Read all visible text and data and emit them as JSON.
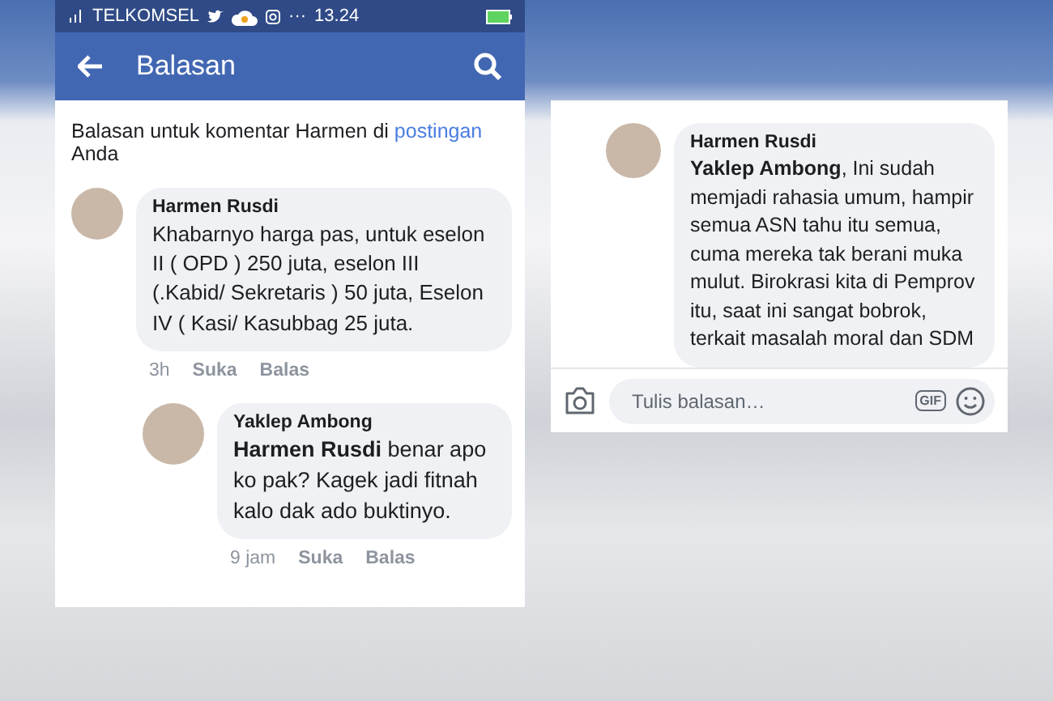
{
  "status_bar": {
    "carrier": "TELKOMSEL",
    "more": "···",
    "time": "13.24"
  },
  "header": {
    "title": "Balasan"
  },
  "intro": {
    "text_before": "Balasan untuk komentar Harmen di",
    "link": "postingan",
    "text_after": "Anda"
  },
  "comments": [
    {
      "author": "Harmen Rusdi",
      "text": "Khabarnyo harga pas, untuk eselon II ( OPD ) 250 juta, eselon III  (.Kabid/ Sekretaris ) 50 juta,  Eselon IV ( Kasi/ Kasubbag   25 juta.",
      "time": "3h",
      "actions": [
        "Suka",
        "Balas"
      ],
      "children": [
        {
          "author": "Yaklep Ambong",
          "text": "**Harmen Rusdi** benar apo ko pak? Kagek jadi fitnah kalo dak ado buktinyo.",
          "time": "9 jam",
          "actions": [
            "Suka",
            "Balas"
          ]
        }
      ]
    }
  ],
  "second_screen": {
    "comment": {
      "author": "Harmen Rusdi",
      "text": "**Yaklep Ambong**, Ini sudah memjadi rahasia umum, hampir  semua ASN tahu itu semua, cuma mereka tak berani muka mulut. Birokrasi kita di Pemprov itu, saat ini sangat bobrok, terkait masalah moral dan SDM"
    },
    "reply_bar": {
      "placeholder": "Tulis balasan…",
      "gif": "GIF"
    }
  }
}
